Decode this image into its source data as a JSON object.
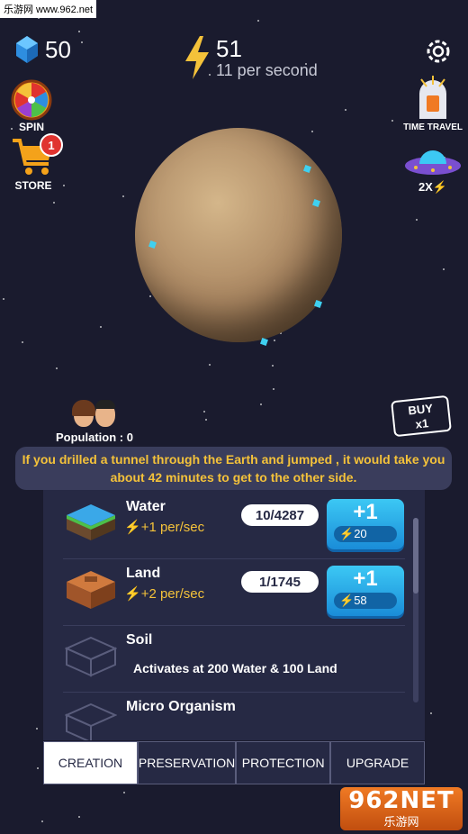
{
  "watermark_top": "乐游网 www.962.net",
  "watermark_bottom": {
    "big": "962NET",
    "small": "乐游网"
  },
  "hud": {
    "gems": "50",
    "energy": "51",
    "energy_rate": "11 per second"
  },
  "side_buttons": {
    "spin": "SPIN",
    "store": "STORE",
    "store_badge": "1",
    "time_travel": "TIME TRAVEL",
    "boost": "2X"
  },
  "population": "Population : 0",
  "buy": {
    "line1": "BUY",
    "line2": "x1"
  },
  "fact": "If you drilled a tunnel through the Earth and jumped , it would take you about 42 minutes to get to the other side.",
  "items": [
    {
      "name": "Water",
      "rate": "+1 per/sec",
      "count": "10/4287",
      "plus": "+1",
      "cost": "20"
    },
    {
      "name": "Land",
      "rate": "+2 per/sec",
      "count": "1/1745",
      "plus": "+1",
      "cost": "58"
    },
    {
      "name": "Soil",
      "lock": "Activates at 200 Water & 100 Land"
    },
    {
      "name": "Micro Organism"
    }
  ],
  "tabs": [
    "CREATION",
    "PRESERVATION",
    "PROTECTION",
    "UPGRADE"
  ],
  "colors": {
    "accent": "#f4c23a",
    "button": "#3cc8f4",
    "background": "#1a1b2e"
  }
}
